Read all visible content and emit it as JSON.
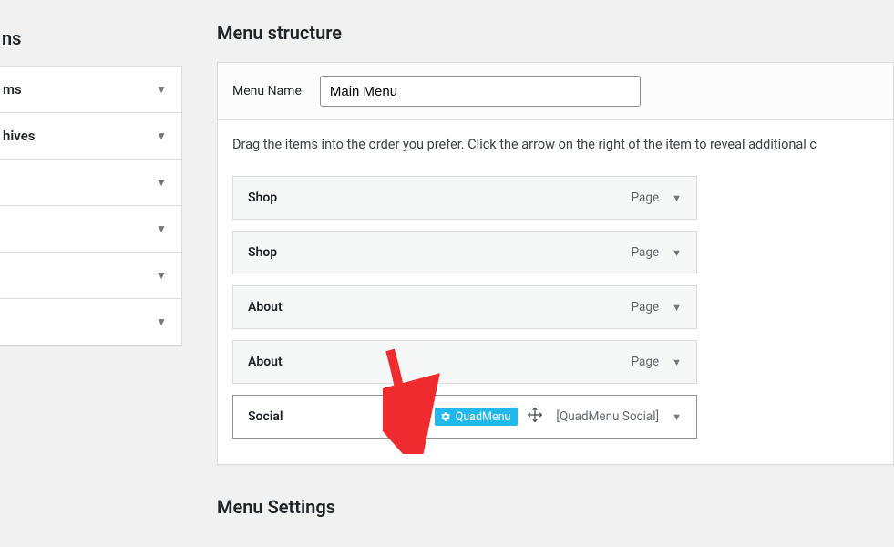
{
  "sidebar": {
    "heading": "ns",
    "items": [
      {
        "label": "ms"
      },
      {
        "label": "hives"
      },
      {
        "label": ""
      },
      {
        "label": ""
      },
      {
        "label": ""
      },
      {
        "label": ""
      }
    ]
  },
  "main": {
    "heading": "Menu structure",
    "menu_name_label": "Menu Name",
    "menu_name_value": "Main Menu",
    "instructions": "Drag the items into the order you prefer. Click the arrow on the right of the item to reveal additional c",
    "items": [
      {
        "title": "Shop",
        "type": "Page",
        "hover": false,
        "badge": null
      },
      {
        "title": "Shop",
        "type": "Page",
        "hover": false,
        "badge": null
      },
      {
        "title": "About",
        "type": "Page",
        "hover": false,
        "badge": null
      },
      {
        "title": "About",
        "type": "Page",
        "hover": false,
        "badge": null
      },
      {
        "title": "Social",
        "type": "[QuadMenu Social]",
        "hover": true,
        "badge": "QuadMenu"
      }
    ],
    "settings_heading": "Menu Settings"
  }
}
